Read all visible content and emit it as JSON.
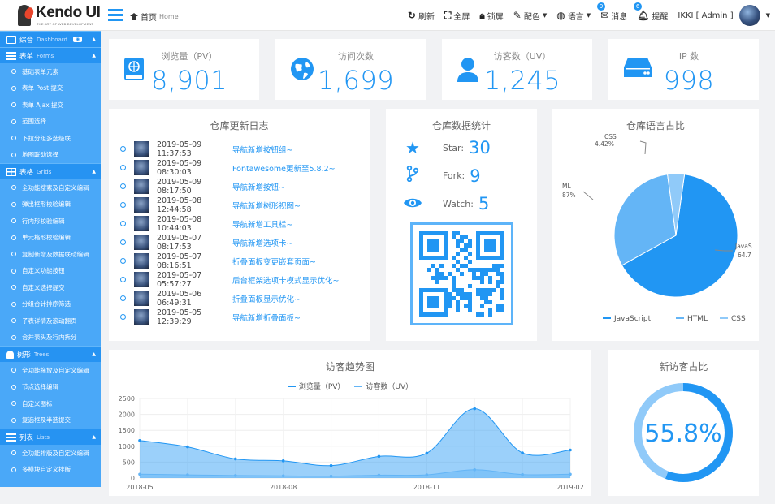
{
  "header": {
    "logo_title": "Kendo UI",
    "logo_subtitle": "THE ART OF WEB DEVELOPMENT",
    "breadcrumb_label": "首页",
    "breadcrumb_en": "Home",
    "tools": {
      "refresh": "刷新",
      "fullscreen": "全屏",
      "lock": "锁屏",
      "color": "配色",
      "language": "语言",
      "messages": "消息",
      "messages_badge": "9",
      "alerts": "提醒",
      "alerts_badge": "6",
      "user": "IKKI [ Admin ]"
    }
  },
  "sidebar": {
    "groups": [
      {
        "label": "综合",
        "en": "Dashboard",
        "icon": "home-icon",
        "items": []
      },
      {
        "label": "表单",
        "en": "Forms",
        "icon": "list-icon",
        "items": [
          "基础表单元素",
          "表单 Post 提交",
          "表单 Ajax 提交",
          "范围选择",
          "下拉分组多选级联",
          "地图联动选择"
        ]
      },
      {
        "label": "表格",
        "en": "Grids",
        "icon": "table-icon",
        "items": [
          "全功能搜索及自定义编辑",
          "弹出框形校验编辑",
          "行内形校验编辑",
          "单元格形校验编辑",
          "复制新增及数据联动编辑",
          "自定义功能按钮",
          "自定义选择提交",
          "分组合计排序筛选",
          "子表详情及滚动翻页",
          "合并表头及行内拆分"
        ]
      },
      {
        "label": "树形",
        "en": "Trees",
        "icon": "bell-icon",
        "items": [
          "全功能拖放及自定义编辑",
          "节点选择编辑",
          "自定义图标",
          "复选框及半选提交"
        ]
      },
      {
        "label": "列表",
        "en": "Lists",
        "icon": "list-icon",
        "items": [
          "全功能排版及自定义编辑",
          "多模块自定义排版"
        ]
      }
    ]
  },
  "stats": [
    {
      "label": "浏览量（PV）",
      "value": "8,901",
      "icon": "book-icon"
    },
    {
      "label": "访问次数",
      "value": "1,699",
      "icon": "globe-icon"
    },
    {
      "label": "访客数（UV）",
      "value": "1,245",
      "icon": "user-icon"
    },
    {
      "label": "IP 数",
      "value": "998",
      "icon": "server-icon"
    }
  ],
  "log": {
    "title": "仓库更新日志",
    "entries": [
      {
        "time": "2019-05-09 11:37:53",
        "msg": "导航新增按钮组~"
      },
      {
        "time": "2019-05-09 08:30:03",
        "msg": "Fontawesome更新至5.8.2~"
      },
      {
        "time": "2019-05-09 08:17:50",
        "msg": "导航新增按钮~"
      },
      {
        "time": "2019-05-08 12:44:58",
        "msg": "导航新增树形视图~"
      },
      {
        "time": "2019-05-08 10:44:03",
        "msg": "导航新增工具栏~"
      },
      {
        "time": "2019-05-07 08:17:53",
        "msg": "导航新增选项卡~"
      },
      {
        "time": "2019-05-07 08:16:51",
        "msg": "折叠面板变更嵌套页面~"
      },
      {
        "time": "2019-05-07 05:57:27",
        "msg": "后台框架选项卡模式显示优化~"
      },
      {
        "time": "2019-05-06 06:49:31",
        "msg": "折叠面板显示优化~"
      },
      {
        "time": "2019-05-05 12:39:29",
        "msg": "导航新增折叠面板~"
      }
    ]
  },
  "repo": {
    "title": "仓库数据统计",
    "star_label": "Star:",
    "star": "30",
    "fork_label": "Fork:",
    "fork": "9",
    "watch_label": "Watch:",
    "watch": "5"
  },
  "colors": {
    "accent": "#2196f3",
    "light": "#64b5f6",
    "lighter": "#90caf9"
  },
  "chart_data": [
    {
      "type": "pie",
      "title": "仓库语言占比",
      "labels": [
        "JavaScript",
        "HTML",
        "CSS"
      ],
      "values": [
        64.7,
        30.87,
        4.42
      ],
      "visible_labels": {
        "css": "CSS",
        "css_pct": "4.42%",
        "html": "ML",
        "html_pct": "87%",
        "js": "JavaS",
        "js_pct": "64.7"
      },
      "legend": "bottom"
    },
    {
      "type": "area",
      "title": "访客趋势图",
      "series": [
        {
          "name": "浏览量（PV）",
          "values": [
            1180,
            980,
            600,
            540,
            390,
            680,
            780,
            2180,
            790,
            880
          ]
        },
        {
          "name": "访客数（UV）",
          "values": [
            120,
            100,
            80,
            70,
            60,
            90,
            100,
            260,
            110,
            120
          ]
        }
      ],
      "x": [
        "2018-05",
        "2018-06",
        "2018-07",
        "2018-08",
        "2018-09",
        "2018-10",
        "2018-11",
        "2018-12",
        "2019-01",
        "2019-02"
      ],
      "x_tick_labels": [
        "2018-05",
        "2018-08",
        "2018-11",
        "2019-02"
      ],
      "yticks": [
        "2500",
        "2000",
        "1500",
        "1000",
        "500",
        "0"
      ],
      "ylim": [
        0,
        2500
      ],
      "legend": "top"
    },
    {
      "type": "pie",
      "title": "新访客占比",
      "values": [
        55.8
      ],
      "display": "55.8%"
    }
  ]
}
